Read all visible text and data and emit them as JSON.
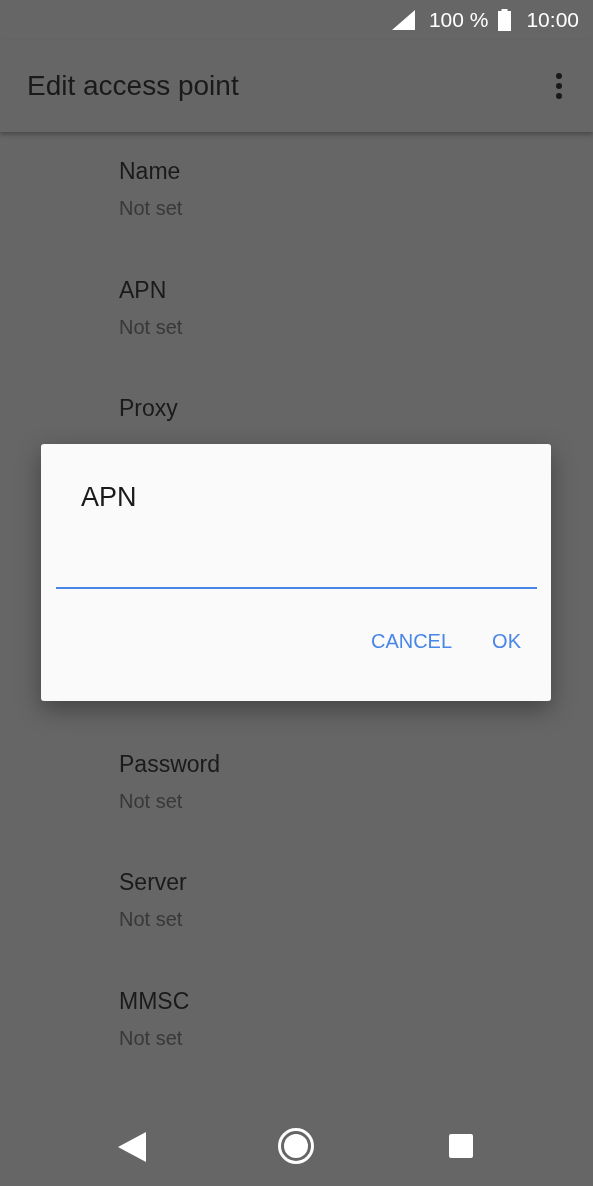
{
  "status_bar": {
    "battery": "100 %",
    "time": "10:00"
  },
  "app_bar": {
    "title": "Edit access point"
  },
  "settings": [
    {
      "title": "Name",
      "value": "Not set"
    },
    {
      "title": "APN",
      "value": "Not set"
    },
    {
      "title": "Proxy"
    },
    {
      "title": "Password",
      "value": "Not set"
    },
    {
      "title": "Server",
      "value": "Not set"
    },
    {
      "title": "MMSC",
      "value": "Not set"
    }
  ],
  "dialog": {
    "title": "APN",
    "buttons": [
      "CANCEL",
      "OK"
    ]
  }
}
